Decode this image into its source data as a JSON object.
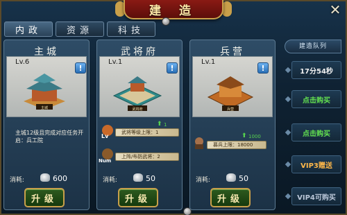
{
  "title": "建 造",
  "close_icon": "close-x-icon",
  "tabs": [
    {
      "label": "内政",
      "active": true
    },
    {
      "label": "资源",
      "active": false
    },
    {
      "label": "科技",
      "active": false
    }
  ],
  "buildings": [
    {
      "name": "主城",
      "level": "Lv.6",
      "plaque": "主城",
      "desc": "主城12级且完成对应任务开启：兵工院",
      "cost_label": "消耗:",
      "cost": "600",
      "upgrade_label": "升级"
    },
    {
      "name": "武将府",
      "level": "Lv.1",
      "plaque": "武将府",
      "stats": [
        {
          "text": "武将等级上限：1",
          "up": "1",
          "icon_text": "Lv"
        },
        {
          "text": "上阵/布防武将：2",
          "icon_text": "Num"
        }
      ],
      "cost_label": "消耗:",
      "cost": "50",
      "upgrade_label": "升级"
    },
    {
      "name": "兵营",
      "level": "Lv.1",
      "plaque": "兵营",
      "stats": [
        {
          "text": "募兵上限：18000",
          "up": "1000"
        }
      ],
      "cost_label": "消耗:",
      "cost": "50",
      "upgrade_label": "升级"
    }
  ],
  "queue": {
    "header": "建造队列",
    "slots": [
      {
        "text": "17分54秒",
        "style": "timer"
      },
      {
        "text": "点击购买",
        "style": "green"
      },
      {
        "text": "点击购买",
        "style": "green"
      },
      {
        "text": "VIP3赠送",
        "style": "vip"
      },
      {
        "text": "VIP4可购买",
        "style": "vip4"
      }
    ]
  },
  "colors": {
    "title_banner": "#8a1a14",
    "gold_border": "#c9a04a",
    "green_text": "#63e050",
    "vip_text": "#ffb84a"
  }
}
